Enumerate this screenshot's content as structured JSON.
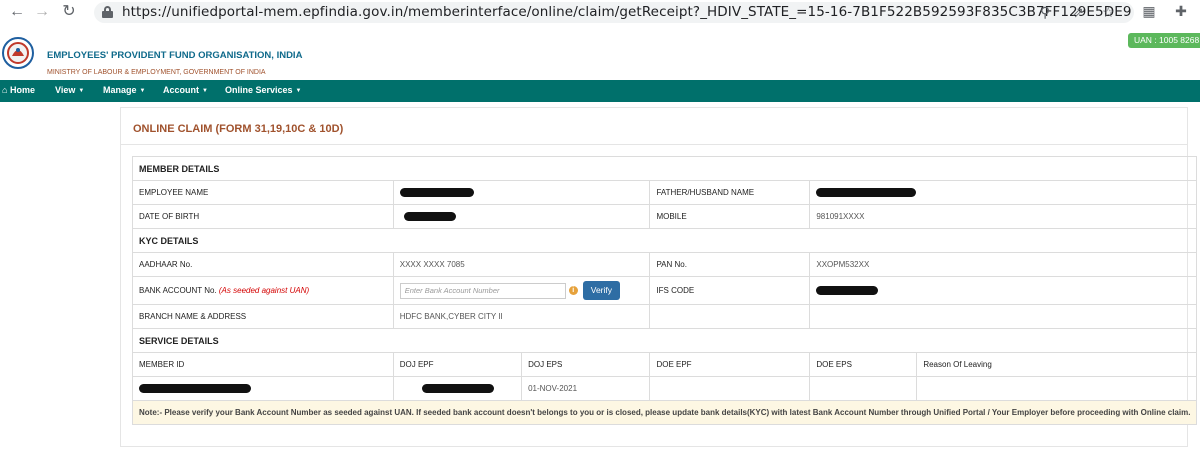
{
  "browser": {
    "url": "https://unifiedportal-mem.epfindia.gov.in/memberinterface/online/claim/getReceipt?_HDIV_STATE_=15-16-7B1F522B592593F835C3B7FF129E5DE9",
    "icons": [
      "back-icon",
      "forward-icon",
      "reload-icon",
      "lock-icon",
      "zoom-icon",
      "share-icon",
      "star-icon",
      "qr-icon",
      "extensions-icon"
    ]
  },
  "header": {
    "uan_badge": "UAN : 1005 8268",
    "org_name": "EMPLOYEES' PROVIDENT FUND ORGANISATION, INDIA",
    "ministry": "MINISTRY OF LABOUR & EMPLOYMENT, GOVERNMENT OF INDIA"
  },
  "nav": {
    "home": "Home",
    "view": "View",
    "manage": "Manage",
    "account": "Account",
    "online_services": "Online Services"
  },
  "page": {
    "title": "ONLINE CLAIM (FORM 31,19,10C & 10D)"
  },
  "member_details": {
    "heading": "MEMBER DETAILS",
    "employee_name_label": "EMPLOYEE NAME",
    "father_name_label": "FATHER/HUSBAND NAME",
    "dob_label": "DATE OF BIRTH",
    "mobile_label": "MOBILE",
    "mobile_value": "981091XXXX"
  },
  "kyc_details": {
    "heading": "KYC DETAILS",
    "aadhaar_label": "AADHAAR No.",
    "aadhaar_value": "XXXX XXXX 7085",
    "pan_label": "PAN No.",
    "pan_value": "XXOPM532XX",
    "bank_label": "BANK ACCOUNT No.",
    "bank_note": "(As seeded against UAN)",
    "bank_placeholder": "Enter Bank Account Number",
    "verify_button": "Verify",
    "ifsc_label": "IFS CODE",
    "branch_label": "BRANCH NAME & ADDRESS",
    "branch_value": "HDFC BANK,CYBER CITY II"
  },
  "service_details": {
    "heading": "SERVICE DETAILS",
    "columns": [
      "MEMBER ID",
      "DOJ EPF",
      "DOJ EPS",
      "DOE EPF",
      "DOE EPS",
      "Reason Of Leaving"
    ],
    "row": {
      "doj_eps": "01-NOV-2021"
    }
  },
  "note": "Note:- Please verify your Bank Account Number as seeded against UAN. If seeded bank account doesn't belongs to you or is closed, please update bank details(KYC) with latest Bank Account Number through Unified Portal / Your Employer before proceeding with Online claim.",
  "colors": {
    "navbar": "#00706b",
    "org_name": "#0f6a8b",
    "title": "#a0522d",
    "verify": "#2e6da4",
    "uan_badge": "#5cb85c",
    "note_bg": "#fdf7e3"
  }
}
